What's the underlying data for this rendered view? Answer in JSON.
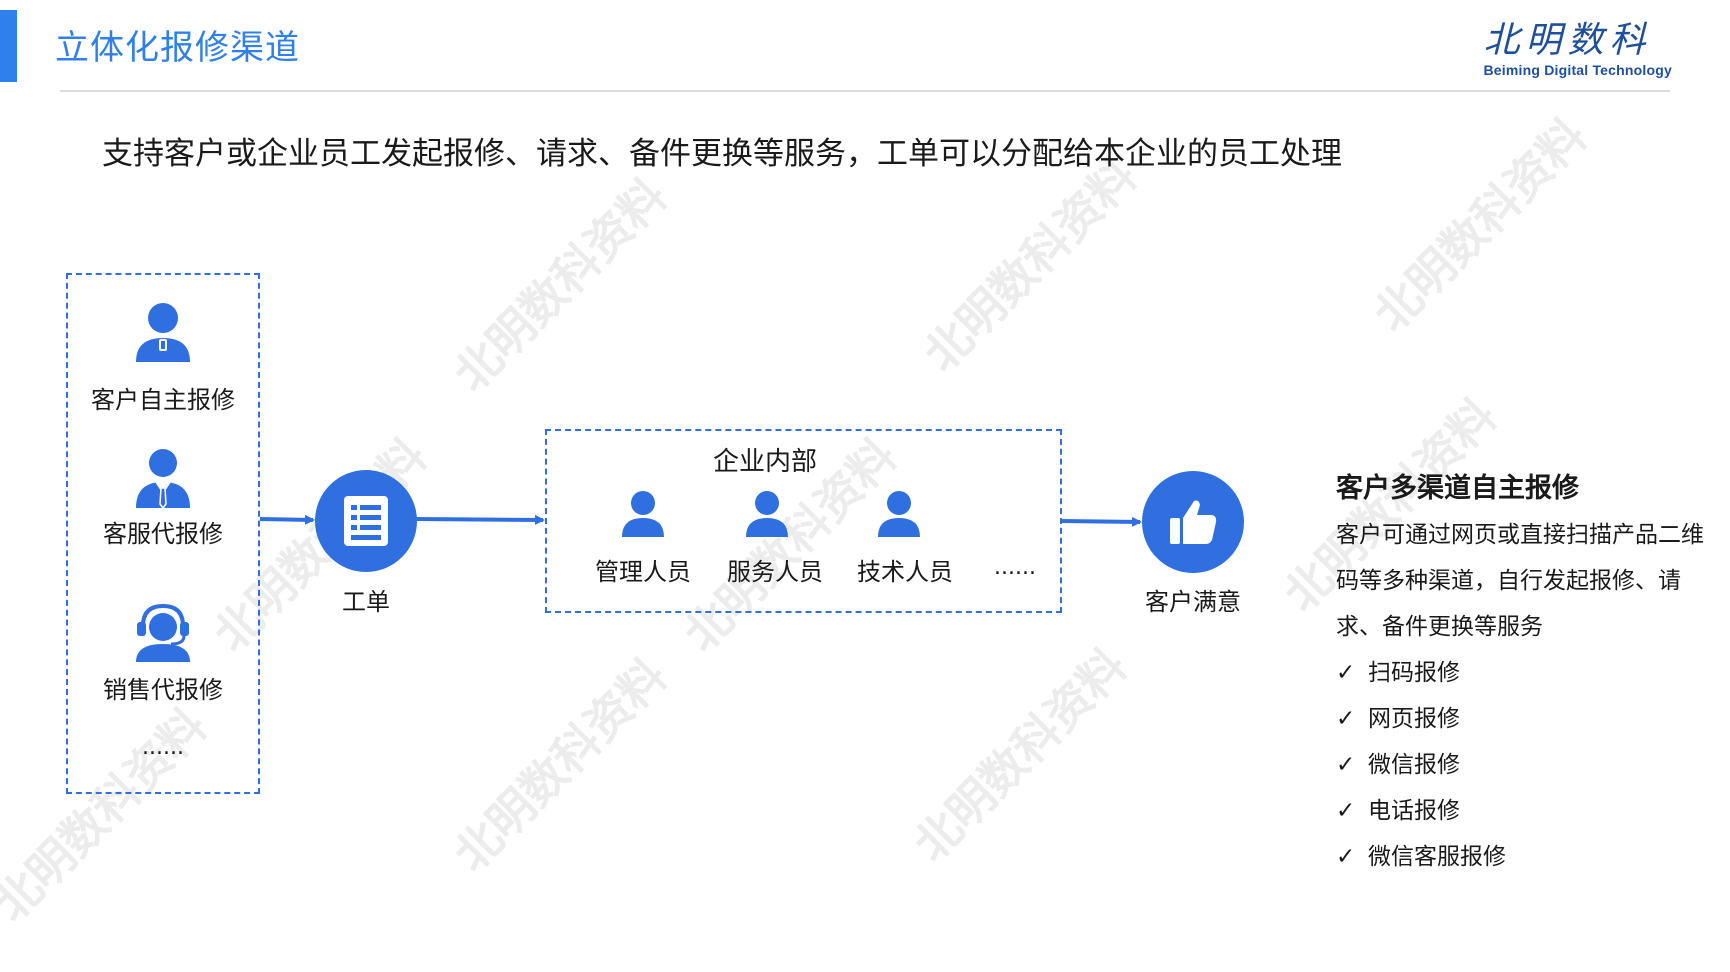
{
  "header": {
    "title": "立体化报修渠道",
    "logo_cn": "北明数科",
    "logo_en": "Beiming Digital Technology"
  },
  "subtitle": "支持客户或企业员工发起报修、请求、备件更换等服务，工单可以分配给本企业的员工处理",
  "diagram": {
    "sources": [
      {
        "label": "客户自主报修",
        "icon": "customer-person-icon"
      },
      {
        "label": "客服代报修",
        "icon": "service-agent-icon"
      },
      {
        "label": "销售代报修",
        "icon": "headset-agent-icon"
      }
    ],
    "sources_more": "......",
    "work_order": {
      "label": "工单",
      "icon": "document-list-icon"
    },
    "enterprise": {
      "title": "企业内部",
      "members": [
        "管理人员",
        "服务人员",
        "技术人员"
      ],
      "more": "......"
    },
    "result": {
      "label": "客户满意",
      "icon": "thumbs-up-icon"
    }
  },
  "right_panel": {
    "heading": "客户多渠道自主报修",
    "description": "客户可通过网页或直接扫描产品二维码等多种渠道，自行发起报修、请求、备件更换等服务",
    "check_mark": "✓",
    "items": [
      "扫码报修",
      "网页报修",
      "微信报修",
      "电话报修",
      "微信客服报修"
    ]
  },
  "watermark_text": "北明数科资料",
  "colors": {
    "accent": "#2f80ed",
    "icon_blue": "#2f6fe0",
    "logo": "#1f4e9c"
  }
}
